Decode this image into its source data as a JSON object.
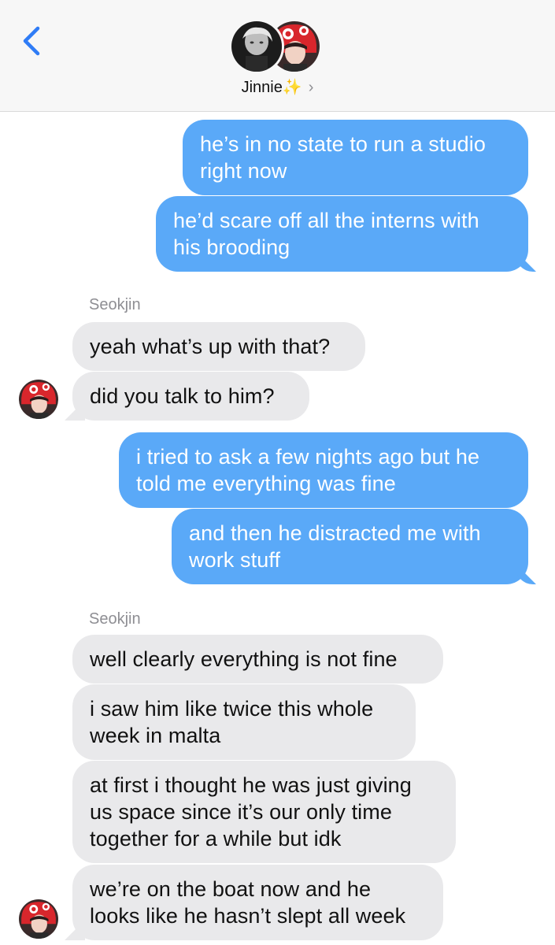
{
  "header": {
    "contact_name": "Jinnie✨",
    "chevron": "›",
    "back_icon": "chevron-left-icon",
    "accent_color": "#2f7cf6"
  },
  "colors": {
    "outgoing_bubble": "#5aa9f8",
    "incoming_bubble": "#e9e9eb",
    "sender_label": "#8e8e93"
  },
  "messages": [
    {
      "from": "me",
      "text": "he’s in no state to run a studio right now"
    },
    {
      "from": "me",
      "text": "he’d scare off all the interns with his brooding"
    },
    {
      "from": "Seokjin",
      "text": "yeah what’s up with that?"
    },
    {
      "from": "Seokjin",
      "text": "did you talk to him?"
    },
    {
      "from": "me",
      "text": "i tried to ask a few nights ago but he told me everything was fine"
    },
    {
      "from": "me",
      "text": "and then he distracted me with work stuff"
    },
    {
      "from": "Seokjin",
      "text": "well clearly everything is not fine"
    },
    {
      "from": "Seokjin",
      "text": "i saw him like twice this whole week in malta"
    },
    {
      "from": "Seokjin",
      "text": "at first i thought he was just giving us space since it’s our only time together for a while but idk"
    },
    {
      "from": "Seokjin",
      "text": "we’re on the boat now and he looks like he hasn’t slept all week"
    }
  ],
  "sender_labels": [
    "Seokjin",
    "Seokjin"
  ]
}
